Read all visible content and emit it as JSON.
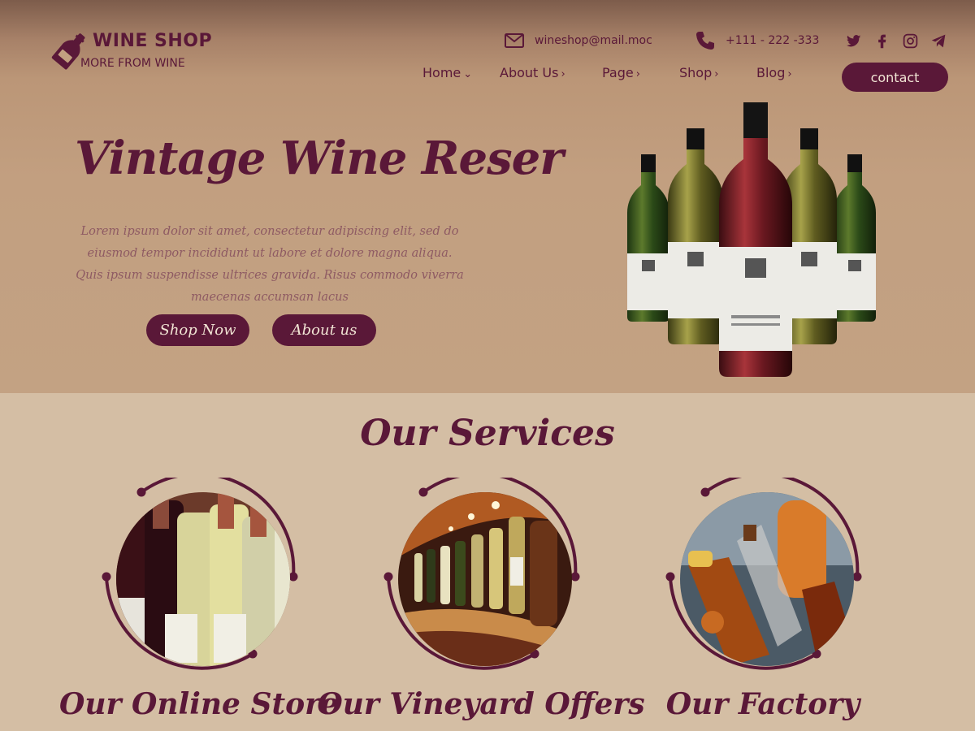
{
  "brand": {
    "name": "WINE SHOP",
    "tagline": "MORE FROM WINE",
    "logo_icon": "wine-bottle-icon"
  },
  "contact": {
    "email": "wineshop@mail.moc",
    "email_icon": "mail-icon",
    "phone": "+111 - 222 -333",
    "phone_icon": "phone-icon"
  },
  "social": [
    "twitter-icon",
    "facebook-icon",
    "instagram-icon",
    "telegram-icon"
  ],
  "nav": {
    "items": [
      {
        "label": "Home",
        "chevron": "⌄"
      },
      {
        "label": "About Us",
        "chevron": "›"
      },
      {
        "label": "Page",
        "chevron": "›"
      },
      {
        "label": "Shop",
        "chevron": "›"
      },
      {
        "label": "Blog",
        "chevron": "›"
      }
    ],
    "contact_button": "contact"
  },
  "hero": {
    "title": "Vintage Wine Reser",
    "text": "Lorem ipsum dolor sit amet, consectetur adipiscing elit, sed do eiusmod tempor incididunt ut labore et dolore magna aliqua. Quis ipsum suspendisse ultrices gravida. Risus commodo viverra maecenas accumsan lacus",
    "buttons": {
      "shop_now": "Shop Now",
      "about_us": "About us"
    }
  },
  "services": {
    "title": "Our Services",
    "items": [
      {
        "name": "Our Online Store"
      },
      {
        "name": "Our Vineyard Offers"
      },
      {
        "name": "Our Factory"
      }
    ]
  },
  "colors": {
    "primary": "#5a1838",
    "hero_bg": "#c3a283",
    "section_bg": "#d4bea4",
    "button_text": "#f1e4d4"
  }
}
